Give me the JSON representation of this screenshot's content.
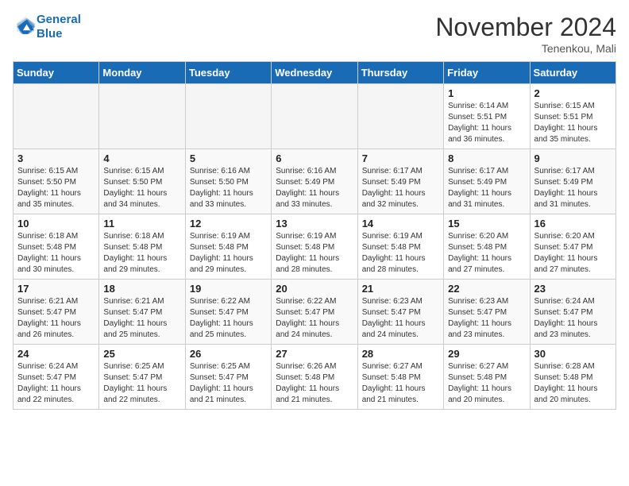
{
  "header": {
    "logo_line1": "General",
    "logo_line2": "Blue",
    "month_title": "November 2024",
    "location": "Tenenkou, Mali"
  },
  "weekdays": [
    "Sunday",
    "Monday",
    "Tuesday",
    "Wednesday",
    "Thursday",
    "Friday",
    "Saturday"
  ],
  "weeks": [
    [
      {
        "day": "",
        "info": ""
      },
      {
        "day": "",
        "info": ""
      },
      {
        "day": "",
        "info": ""
      },
      {
        "day": "",
        "info": ""
      },
      {
        "day": "",
        "info": ""
      },
      {
        "day": "1",
        "info": "Sunrise: 6:14 AM\nSunset: 5:51 PM\nDaylight: 11 hours and 36 minutes."
      },
      {
        "day": "2",
        "info": "Sunrise: 6:15 AM\nSunset: 5:51 PM\nDaylight: 11 hours and 35 minutes."
      }
    ],
    [
      {
        "day": "3",
        "info": "Sunrise: 6:15 AM\nSunset: 5:50 PM\nDaylight: 11 hours and 35 minutes."
      },
      {
        "day": "4",
        "info": "Sunrise: 6:15 AM\nSunset: 5:50 PM\nDaylight: 11 hours and 34 minutes."
      },
      {
        "day": "5",
        "info": "Sunrise: 6:16 AM\nSunset: 5:50 PM\nDaylight: 11 hours and 33 minutes."
      },
      {
        "day": "6",
        "info": "Sunrise: 6:16 AM\nSunset: 5:49 PM\nDaylight: 11 hours and 33 minutes."
      },
      {
        "day": "7",
        "info": "Sunrise: 6:17 AM\nSunset: 5:49 PM\nDaylight: 11 hours and 32 minutes."
      },
      {
        "day": "8",
        "info": "Sunrise: 6:17 AM\nSunset: 5:49 PM\nDaylight: 11 hours and 31 minutes."
      },
      {
        "day": "9",
        "info": "Sunrise: 6:17 AM\nSunset: 5:49 PM\nDaylight: 11 hours and 31 minutes."
      }
    ],
    [
      {
        "day": "10",
        "info": "Sunrise: 6:18 AM\nSunset: 5:48 PM\nDaylight: 11 hours and 30 minutes."
      },
      {
        "day": "11",
        "info": "Sunrise: 6:18 AM\nSunset: 5:48 PM\nDaylight: 11 hours and 29 minutes."
      },
      {
        "day": "12",
        "info": "Sunrise: 6:19 AM\nSunset: 5:48 PM\nDaylight: 11 hours and 29 minutes."
      },
      {
        "day": "13",
        "info": "Sunrise: 6:19 AM\nSunset: 5:48 PM\nDaylight: 11 hours and 28 minutes."
      },
      {
        "day": "14",
        "info": "Sunrise: 6:19 AM\nSunset: 5:48 PM\nDaylight: 11 hours and 28 minutes."
      },
      {
        "day": "15",
        "info": "Sunrise: 6:20 AM\nSunset: 5:48 PM\nDaylight: 11 hours and 27 minutes."
      },
      {
        "day": "16",
        "info": "Sunrise: 6:20 AM\nSunset: 5:47 PM\nDaylight: 11 hours and 27 minutes."
      }
    ],
    [
      {
        "day": "17",
        "info": "Sunrise: 6:21 AM\nSunset: 5:47 PM\nDaylight: 11 hours and 26 minutes."
      },
      {
        "day": "18",
        "info": "Sunrise: 6:21 AM\nSunset: 5:47 PM\nDaylight: 11 hours and 25 minutes."
      },
      {
        "day": "19",
        "info": "Sunrise: 6:22 AM\nSunset: 5:47 PM\nDaylight: 11 hours and 25 minutes."
      },
      {
        "day": "20",
        "info": "Sunrise: 6:22 AM\nSunset: 5:47 PM\nDaylight: 11 hours and 24 minutes."
      },
      {
        "day": "21",
        "info": "Sunrise: 6:23 AM\nSunset: 5:47 PM\nDaylight: 11 hours and 24 minutes."
      },
      {
        "day": "22",
        "info": "Sunrise: 6:23 AM\nSunset: 5:47 PM\nDaylight: 11 hours and 23 minutes."
      },
      {
        "day": "23",
        "info": "Sunrise: 6:24 AM\nSunset: 5:47 PM\nDaylight: 11 hours and 23 minutes."
      }
    ],
    [
      {
        "day": "24",
        "info": "Sunrise: 6:24 AM\nSunset: 5:47 PM\nDaylight: 11 hours and 22 minutes."
      },
      {
        "day": "25",
        "info": "Sunrise: 6:25 AM\nSunset: 5:47 PM\nDaylight: 11 hours and 22 minutes."
      },
      {
        "day": "26",
        "info": "Sunrise: 6:25 AM\nSunset: 5:47 PM\nDaylight: 11 hours and 21 minutes."
      },
      {
        "day": "27",
        "info": "Sunrise: 6:26 AM\nSunset: 5:48 PM\nDaylight: 11 hours and 21 minutes."
      },
      {
        "day": "28",
        "info": "Sunrise: 6:27 AM\nSunset: 5:48 PM\nDaylight: 11 hours and 21 minutes."
      },
      {
        "day": "29",
        "info": "Sunrise: 6:27 AM\nSunset: 5:48 PM\nDaylight: 11 hours and 20 minutes."
      },
      {
        "day": "30",
        "info": "Sunrise: 6:28 AM\nSunset: 5:48 PM\nDaylight: 11 hours and 20 minutes."
      }
    ]
  ]
}
